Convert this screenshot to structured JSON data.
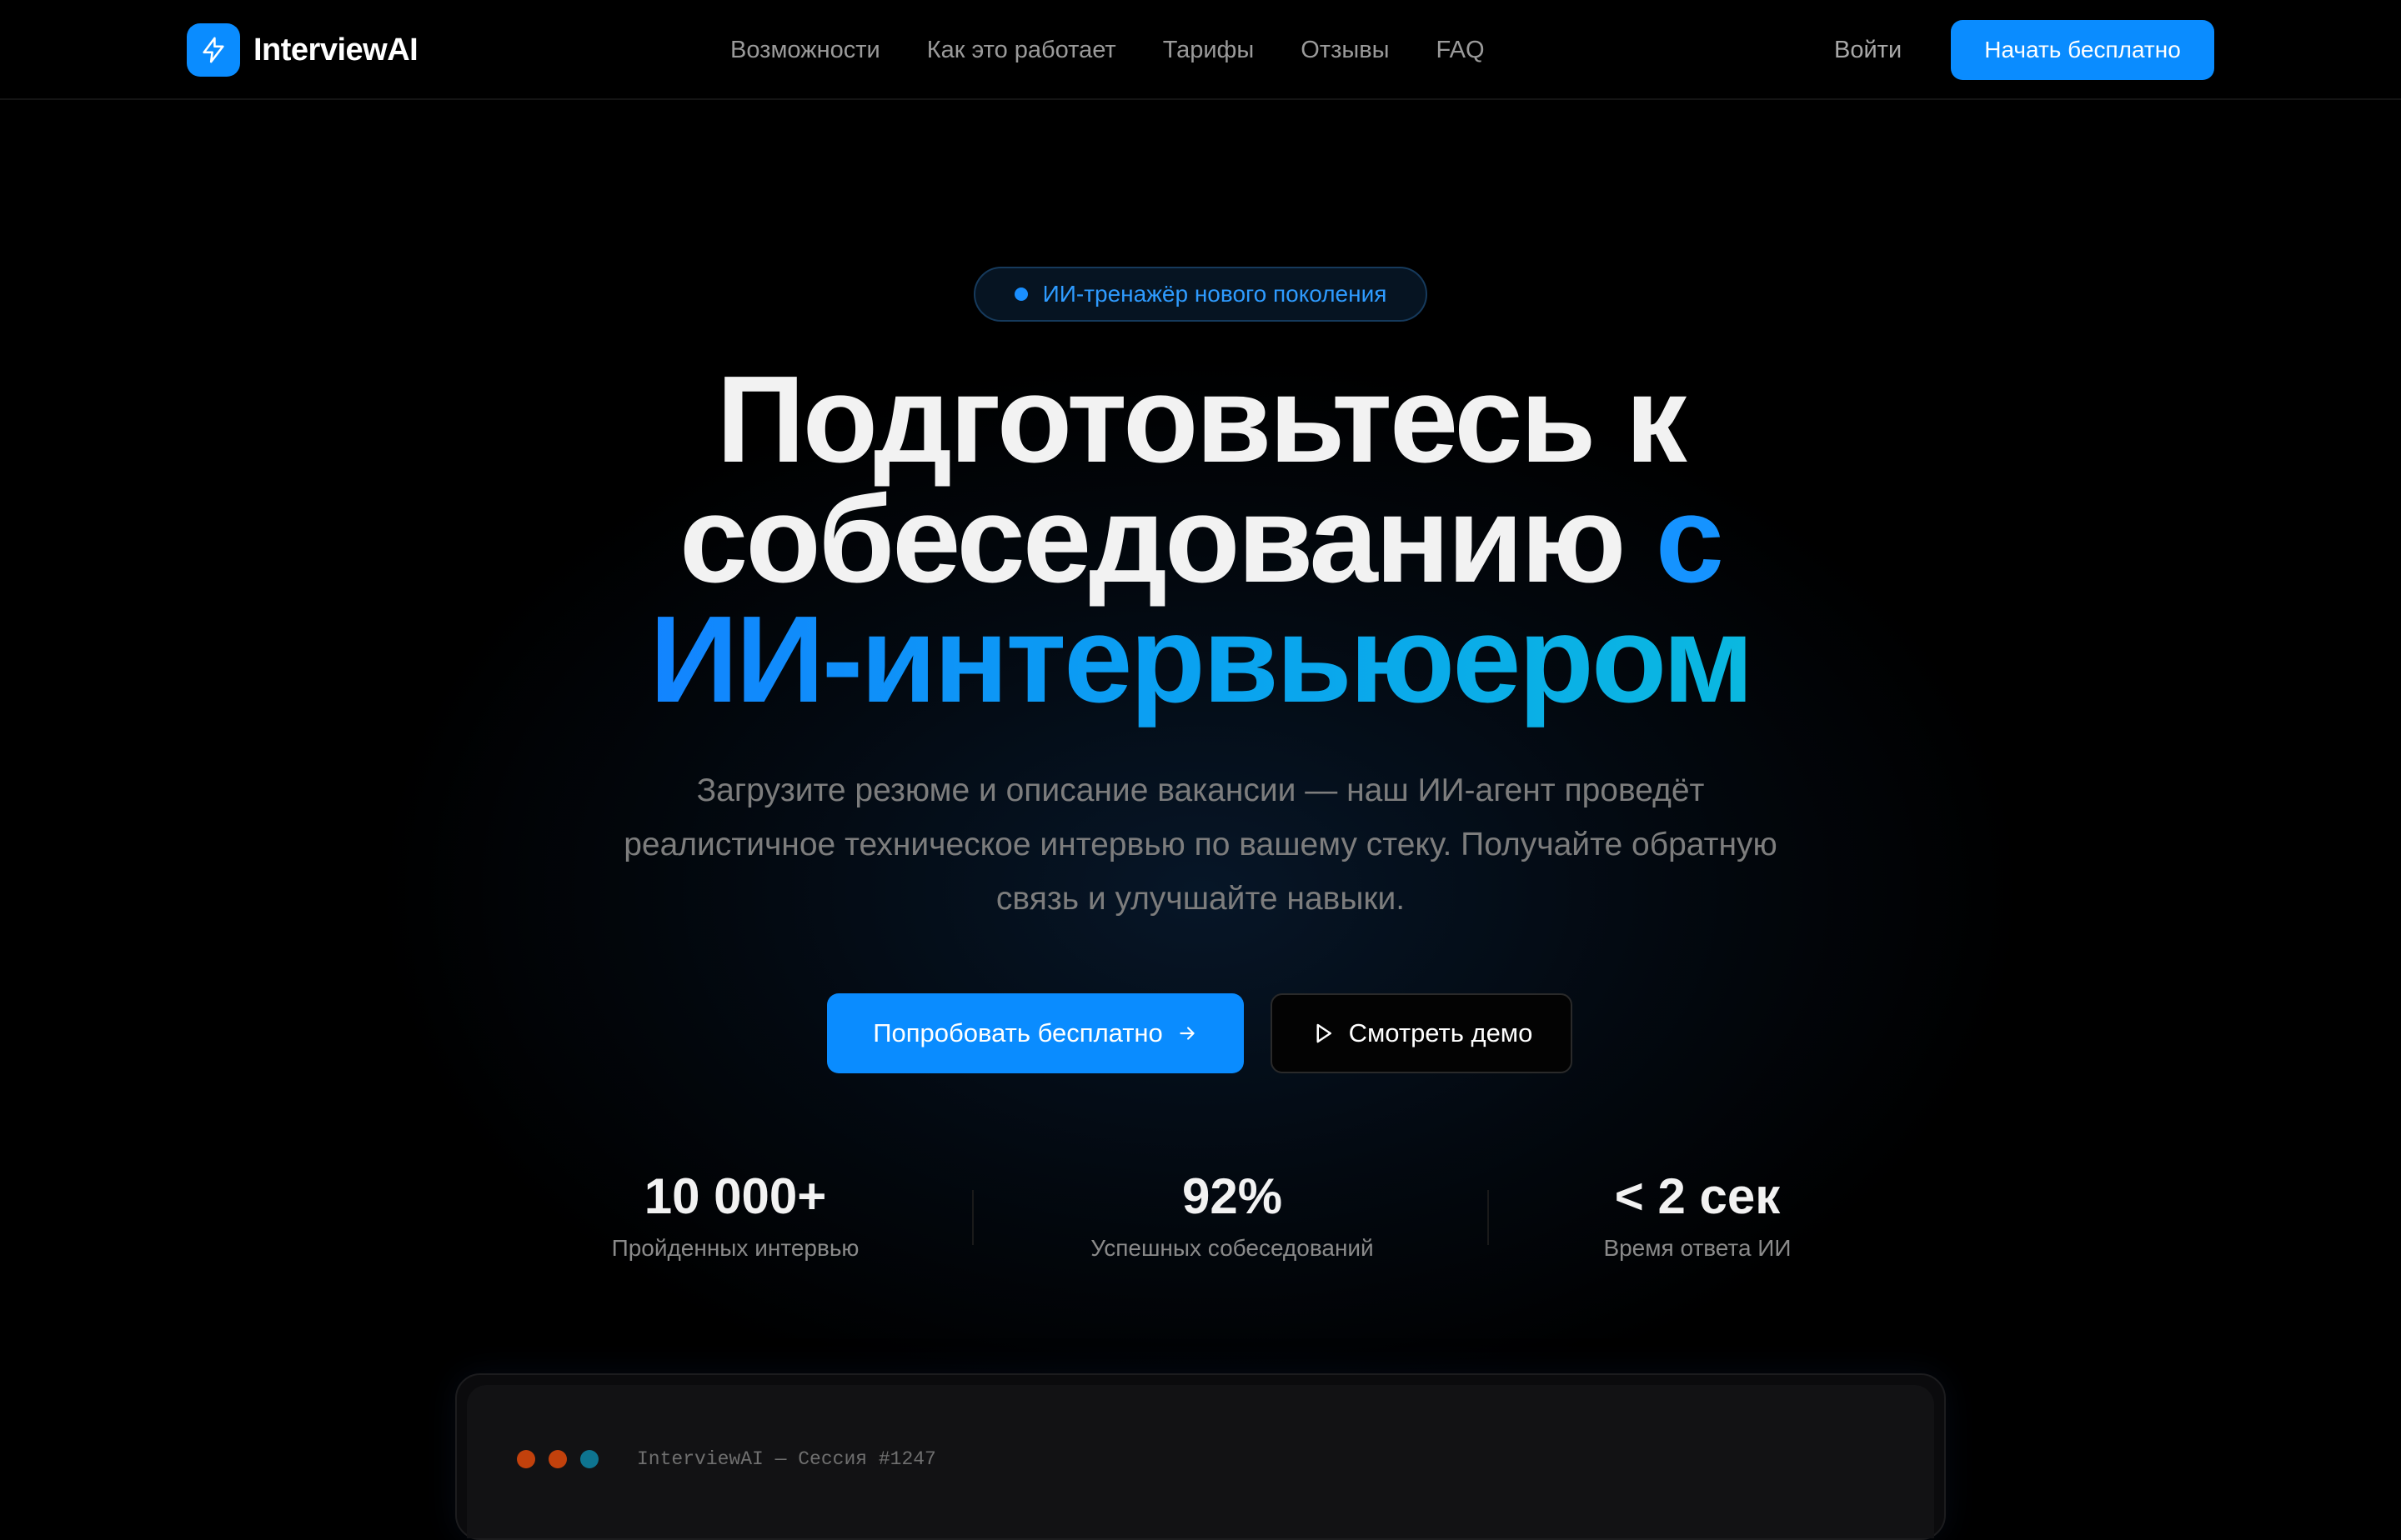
{
  "nav": {
    "brand": "InterviewAI",
    "logo_icon": "lightning-icon",
    "links": [
      "Возможности",
      "Как это работает",
      "Тарифы",
      "Отзывы",
      "FAQ"
    ],
    "login": "Войти",
    "cta": "Начать бесплатно"
  },
  "hero": {
    "badge": "ИИ-тренажёр нового поколения",
    "headline_part1": "Подготовьтесь к",
    "headline_part2": "собеседованию ",
    "headline_accent": "с",
    "headline_part3": "ИИ-интервьюером",
    "subtitle": "Загрузите резюме и описание вакансии — наш ИИ-агент проведёт реалистичное техническое интервью по вашему стеку. Получайте обратную связь и улучшайте навыки.",
    "primary_button": "Попробовать бесплатно",
    "secondary_button": "Смотреть демо"
  },
  "stats": [
    {
      "value": "10 000+",
      "label": "Пройденных интервью"
    },
    {
      "value": "92%",
      "label": "Успешных собеседований"
    },
    {
      "value": "< 2 сек",
      "label": "Время ответа ИИ"
    }
  ],
  "session_window": {
    "title": "InterviewAI — Сессия #1247",
    "dot_colors": [
      "#c2410c",
      "#c2410c",
      "#0e7490"
    ]
  },
  "colors": {
    "accent": "#0a8cff",
    "background": "#000000"
  }
}
